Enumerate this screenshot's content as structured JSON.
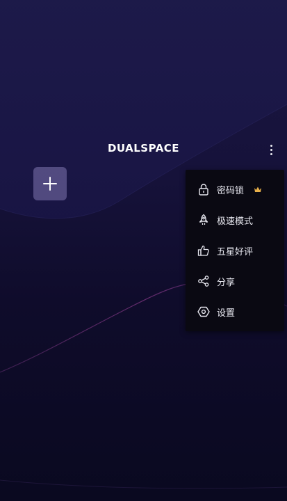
{
  "app": {
    "logo_text": "DUALSPACE"
  },
  "header": {
    "more_icon": "more-vertical-icon"
  },
  "home": {
    "add_icon": "plus-icon"
  },
  "menu": {
    "items": [
      {
        "label": "密码锁",
        "icon": "lock-icon",
        "badge_icon": "crown-icon",
        "badge_color": "#e8b04a"
      },
      {
        "label": "极速模式",
        "icon": "rocket-icon"
      },
      {
        "label": "五星好评",
        "icon": "thumbs-up-icon"
      },
      {
        "label": "分享",
        "icon": "share-icon"
      },
      {
        "label": "设置",
        "icon": "settings-icon"
      }
    ]
  },
  "colors": {
    "background_top": "#1a1642",
    "background_bottom": "#0a0920",
    "menu_background": "#0a0912",
    "accent_line": "#8a3a8a",
    "crown": "#e8b04a"
  }
}
